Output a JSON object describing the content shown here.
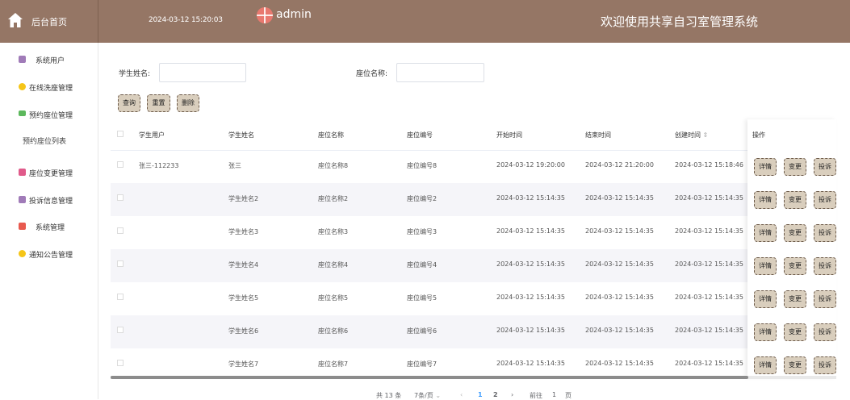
{
  "header": {
    "home_label": "后台首页",
    "datetime": "2024-03-12 15:20:03",
    "user": "admin",
    "system_title": "欢迎使用共享自习室管理系统"
  },
  "sidebar": {
    "items": [
      {
        "label": "系统用户",
        "icon": "user-icon",
        "color": "#a07bb8"
      },
      {
        "label": "在线洗座管理",
        "icon": "badge-icon",
        "color": "#f5c518"
      },
      {
        "label": "预约座位管理",
        "icon": "chat-icon",
        "color": "#5cb85c"
      },
      {
        "label": "座位变更管理",
        "icon": "swap-icon",
        "color": "#e05a8a"
      },
      {
        "label": "投诉信息管理",
        "icon": "user-icon",
        "color": "#a07bb8"
      },
      {
        "label": "系统管理",
        "icon": "grid-icon",
        "color": "#e85a4f"
      },
      {
        "label": "通知公告管理",
        "icon": "badge-icon",
        "color": "#f5c518"
      }
    ],
    "sub_item": "预约座位列表"
  },
  "search": {
    "student_name_label": "学生姓名:",
    "seat_name_label": "座位名称:",
    "student_name_value": "",
    "seat_name_value": "",
    "query_btn": "查询",
    "reset_btn": "重置",
    "delete_btn": "删除"
  },
  "table": {
    "headers": [
      "学生用户",
      "学生姓名",
      "座位名称",
      "座位编号",
      "开始时间",
      "结束时间",
      "创建时间",
      "操作"
    ],
    "sort_icon": "⇕",
    "rows": [
      {
        "user": "张三-112233",
        "name": "张三",
        "seat_name": "座位名称8",
        "seat_no": "座位编号8",
        "start": "2024-03-12 19:20:00",
        "end": "2024-03-12 21:20:00",
        "created": "2024-03-12 15:18:46"
      },
      {
        "user": "",
        "name": "学生姓名2",
        "seat_name": "座位名称2",
        "seat_no": "座位编号2",
        "start": "2024-03-12 15:14:35",
        "end": "2024-03-12 15:14:35",
        "created": "2024-03-12 15:14:35"
      },
      {
        "user": "",
        "name": "学生姓名3",
        "seat_name": "座位名称3",
        "seat_no": "座位编号3",
        "start": "2024-03-12 15:14:35",
        "end": "2024-03-12 15:14:35",
        "created": "2024-03-12 15:14:35"
      },
      {
        "user": "",
        "name": "学生姓名4",
        "seat_name": "座位名称4",
        "seat_no": "座位编号4",
        "start": "2024-03-12 15:14:35",
        "end": "2024-03-12 15:14:35",
        "created": "2024-03-12 15:14:35"
      },
      {
        "user": "",
        "name": "学生姓名5",
        "seat_name": "座位名称5",
        "seat_no": "座位编号5",
        "start": "2024-03-12 15:14:35",
        "end": "2024-03-12 15:14:35",
        "created": "2024-03-12 15:14:35"
      },
      {
        "user": "",
        "name": "学生姓名6",
        "seat_name": "座位名称6",
        "seat_no": "座位编号6",
        "start": "2024-03-12 15:14:35",
        "end": "2024-03-12 15:14:35",
        "created": "2024-03-12 15:14:35"
      },
      {
        "user": "",
        "name": "学生姓名7",
        "seat_name": "座位名称7",
        "seat_no": "座位编号7",
        "start": "2024-03-12 15:14:35",
        "end": "2024-03-12 15:14:35",
        "created": "2024-03-12 15:14:35"
      }
    ],
    "actions": [
      "详情",
      "变更",
      "投诉"
    ]
  },
  "pagination": {
    "total": "共 13 条",
    "page_size": "7条/页",
    "pages": [
      "1",
      "2"
    ],
    "goto_label": "前往",
    "goto_value": "1",
    "page_unit": "页"
  },
  "colors": {
    "header": "#957665",
    "button": "#d9cebd",
    "active_page": "#409eff"
  }
}
